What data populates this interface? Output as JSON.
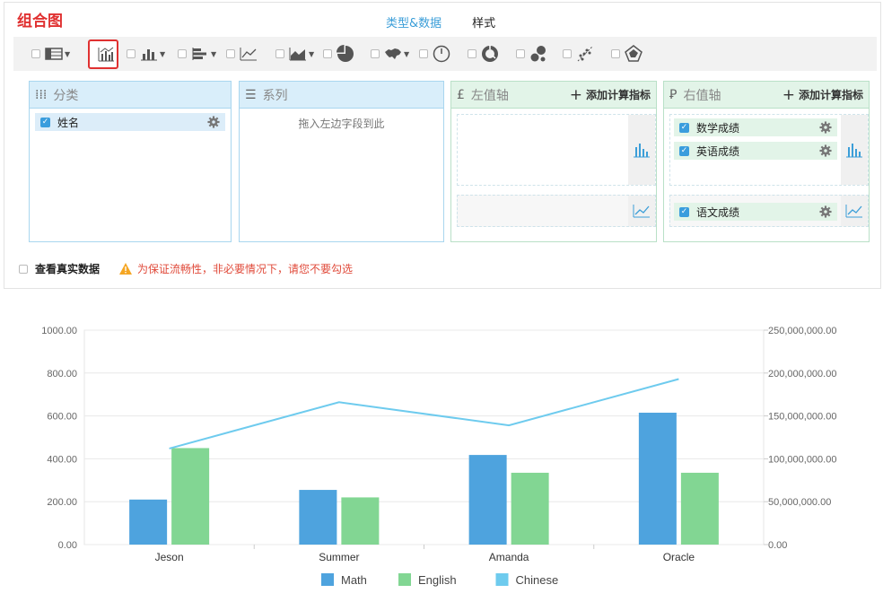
{
  "title": "组合图",
  "tabs": [
    {
      "label": "类型&数据"
    },
    {
      "label": "样式"
    }
  ],
  "panels": {
    "category": {
      "title": "分类",
      "fields": [
        {
          "label": "姓名"
        }
      ]
    },
    "series": {
      "title": "系列",
      "hint": "拖入左边字段到此"
    },
    "left_axis": {
      "title": "左值轴",
      "add": "添加计算指标"
    },
    "right_axis": {
      "title": "右值轴",
      "add": "添加计算指标",
      "fields": [
        {
          "label": "数学成绩"
        },
        {
          "label": "英语成绩"
        },
        {
          "label": "语文成绩"
        }
      ]
    }
  },
  "options": {
    "real_data": "查看真实数据",
    "warning": "为保证流畅性，非必要情况下，请您不要勾选"
  },
  "colors": {
    "accent": "#3b9ed8",
    "math": "#4ea3de",
    "english": "#82d693",
    "chinese": "#6ecbee",
    "warn": "#e04a3a"
  },
  "chart_data": {
    "type": "bar",
    "categories": [
      "Jeson",
      "Summer",
      "Amanda",
      "Oracle"
    ],
    "series": [
      {
        "name": "Math",
        "type": "bar",
        "axis": "left",
        "values": [
          210,
          255,
          418,
          615
        ]
      },
      {
        "name": "English",
        "type": "bar",
        "axis": "left",
        "values": [
          450,
          220,
          335,
          335
        ]
      },
      {
        "name": "Chinese",
        "type": "line",
        "axis": "right",
        "values": [
          112000000,
          166000000,
          139000000,
          193000000
        ]
      }
    ],
    "left_axis": {
      "ylim": [
        0,
        1000
      ],
      "ticks": [
        "0.00",
        "200.00",
        "400.00",
        "600.00",
        "800.00",
        "1000.00"
      ]
    },
    "right_axis": {
      "ylim": [
        0,
        250000000
      ],
      "ticks": [
        "0.00",
        "50,000,000.00",
        "100,000,000.00",
        "150,000,000.00",
        "200,000,000.00",
        "250,000,000.00"
      ]
    },
    "legend": "bottom",
    "grid": true
  }
}
